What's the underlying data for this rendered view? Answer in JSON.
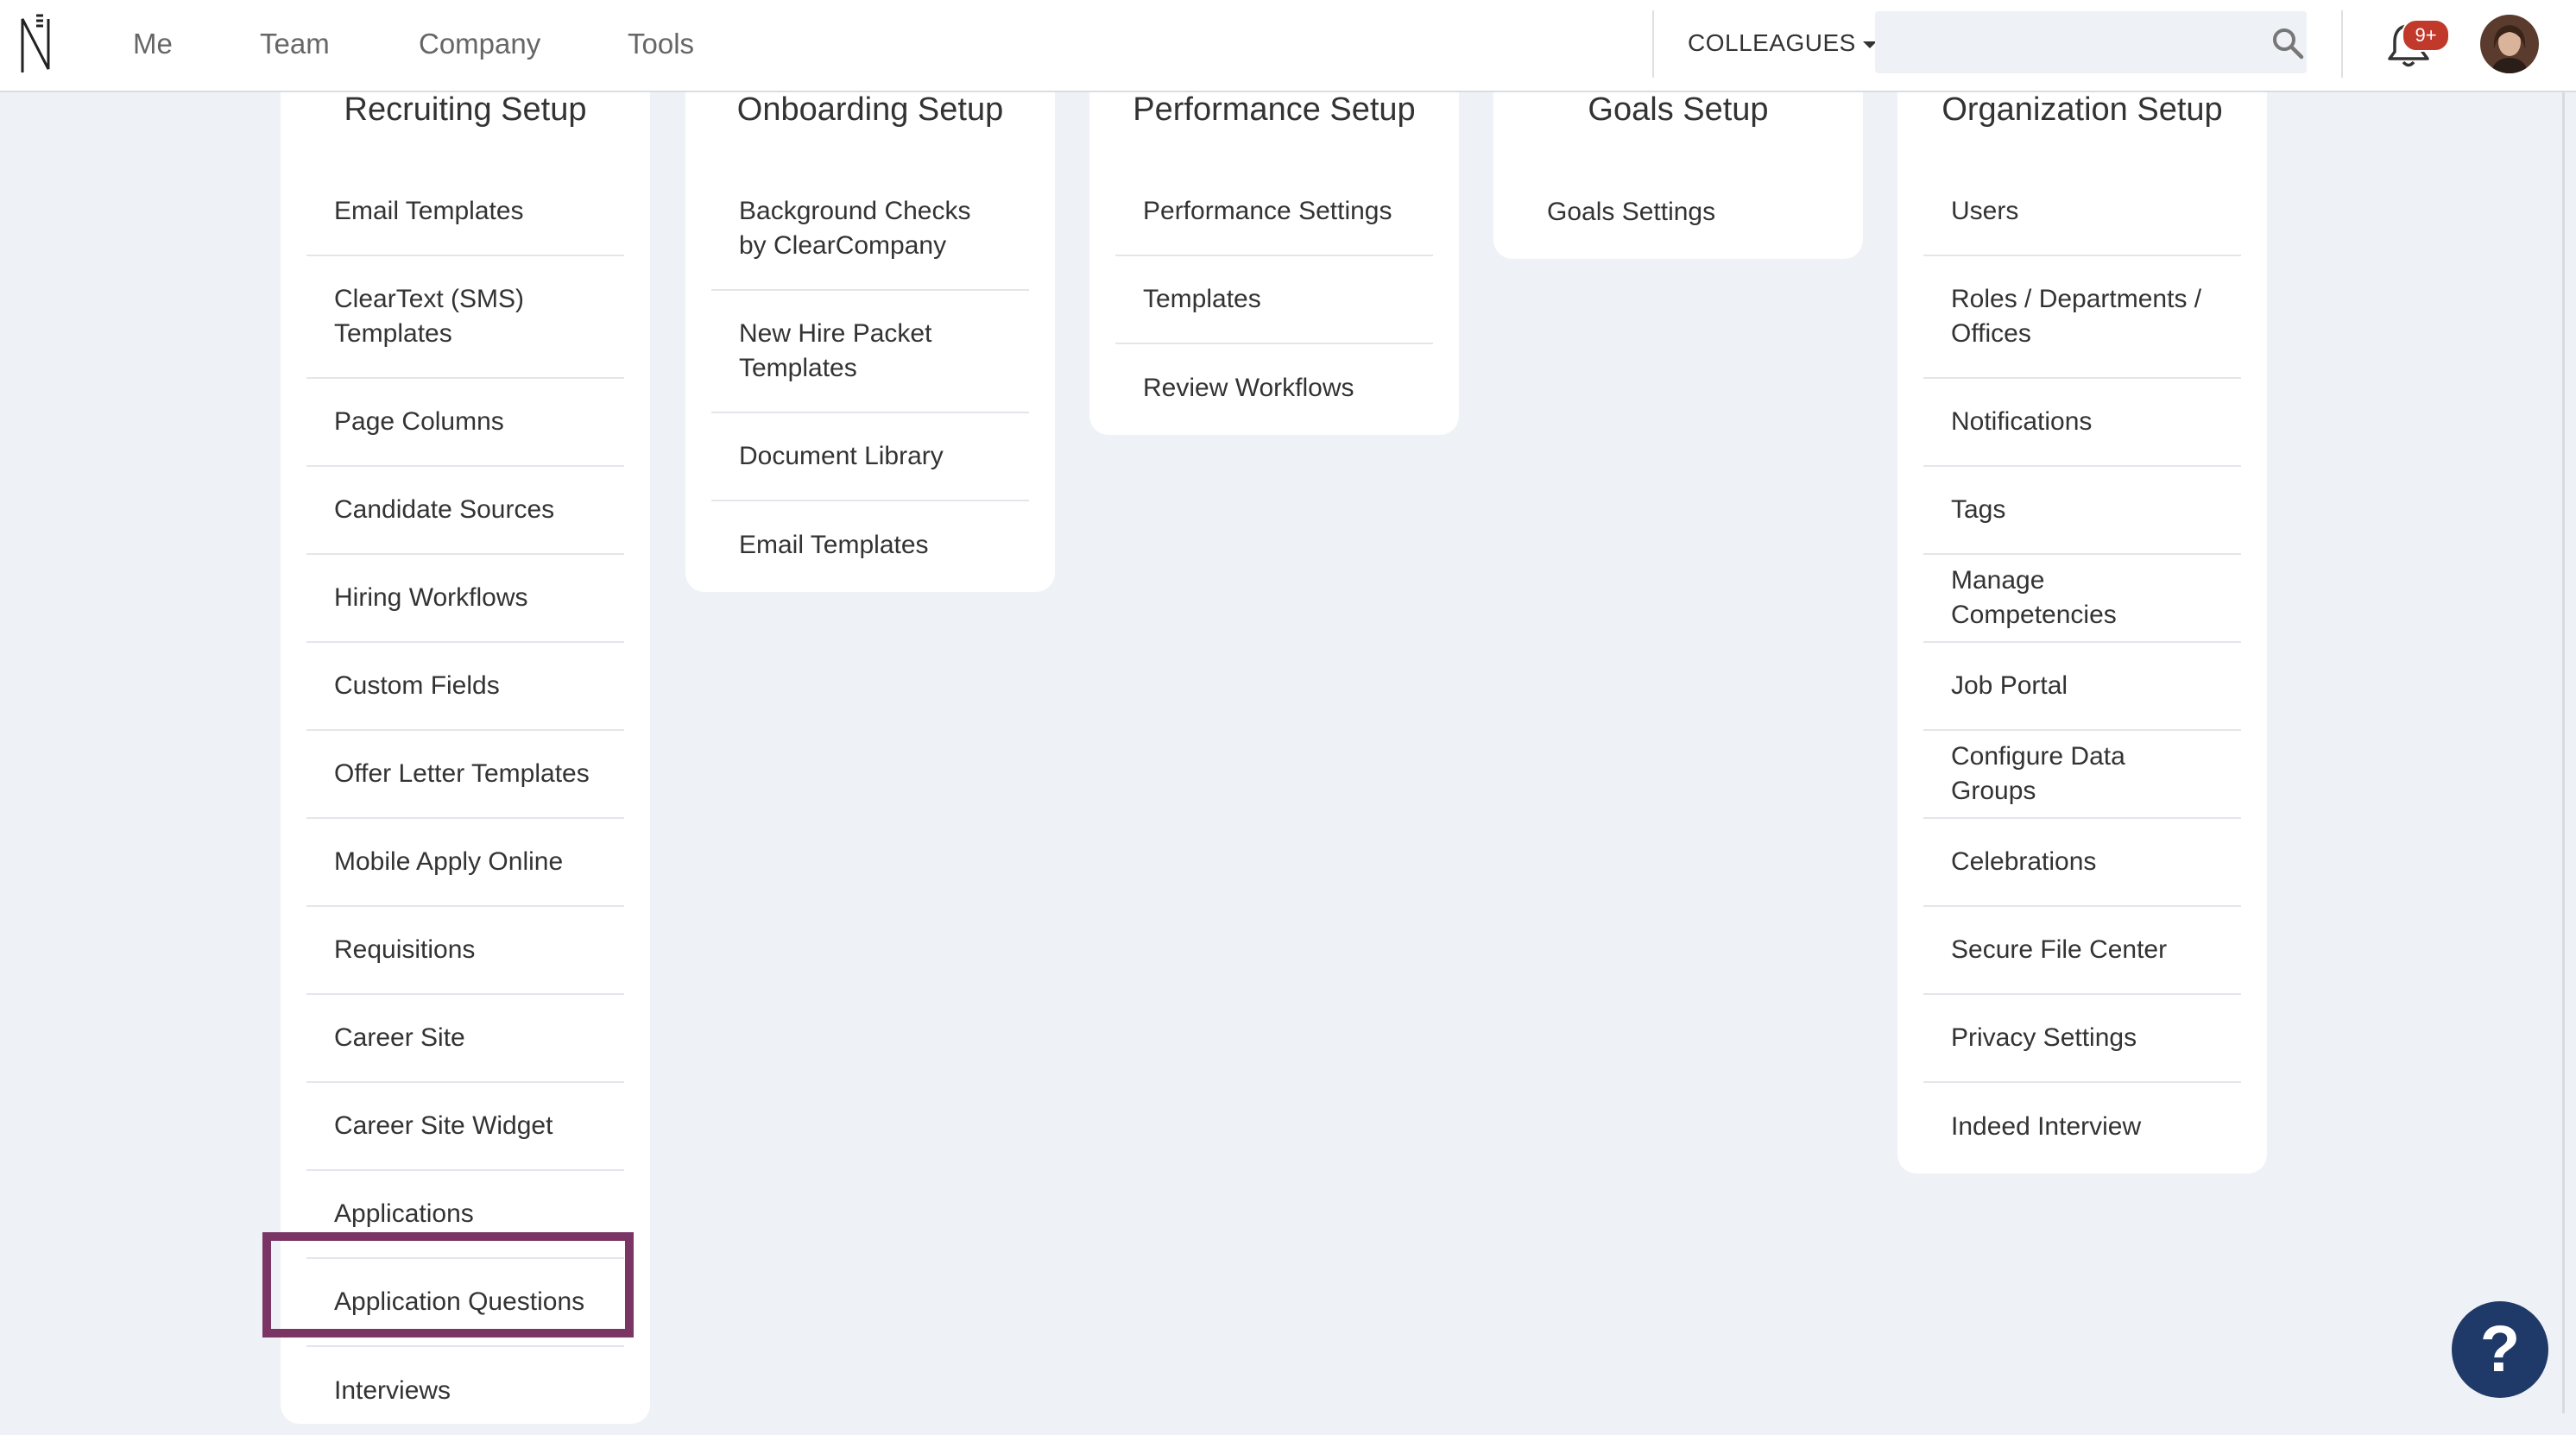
{
  "nav": {
    "items": [
      "Me",
      "Team",
      "Company",
      "Tools"
    ],
    "colleagues_label": "COLLEAGUES",
    "search_placeholder": "",
    "notification_badge": "9+"
  },
  "icons": {
    "logo": "brand-logo",
    "search": "search-icon",
    "bell": "bell-icon",
    "help": "help-icon"
  },
  "colors": {
    "highlight": "#7a3565",
    "help_button": "#1f3a68",
    "badge": "#c0392b"
  },
  "sections": [
    {
      "title": "Recruiting Setup",
      "items": [
        "Email Templates",
        "ClearText (SMS) Templates",
        "Page Columns",
        "Candidate Sources",
        "Hiring Workflows",
        "Custom Fields",
        "Offer Letter Templates",
        "Mobile Apply Online",
        "Requisitions",
        "Career Site",
        "Career Site Widget",
        "Applications",
        "Application Questions",
        "Interviews"
      ]
    },
    {
      "title": "Onboarding Setup",
      "items": [
        "Background Checks by ClearCompany",
        "New Hire Packet Templates",
        "Document Library",
        "Email Templates"
      ]
    },
    {
      "title": "Performance Setup",
      "items": [
        "Performance Settings",
        "Templates",
        "Review Workflows"
      ]
    },
    {
      "title": "Goals Setup",
      "items": [
        "Goals Settings"
      ]
    },
    {
      "title": "Organization Setup",
      "items": [
        "Users",
        "Roles / Departments / Offices",
        "Notifications",
        "Tags",
        "Manage Competencies",
        "Job Portal",
        "Configure Data Groups",
        "Celebrations",
        "Secure File Center",
        "Privacy Settings",
        "Indeed Interview"
      ]
    }
  ],
  "help_label": "?"
}
